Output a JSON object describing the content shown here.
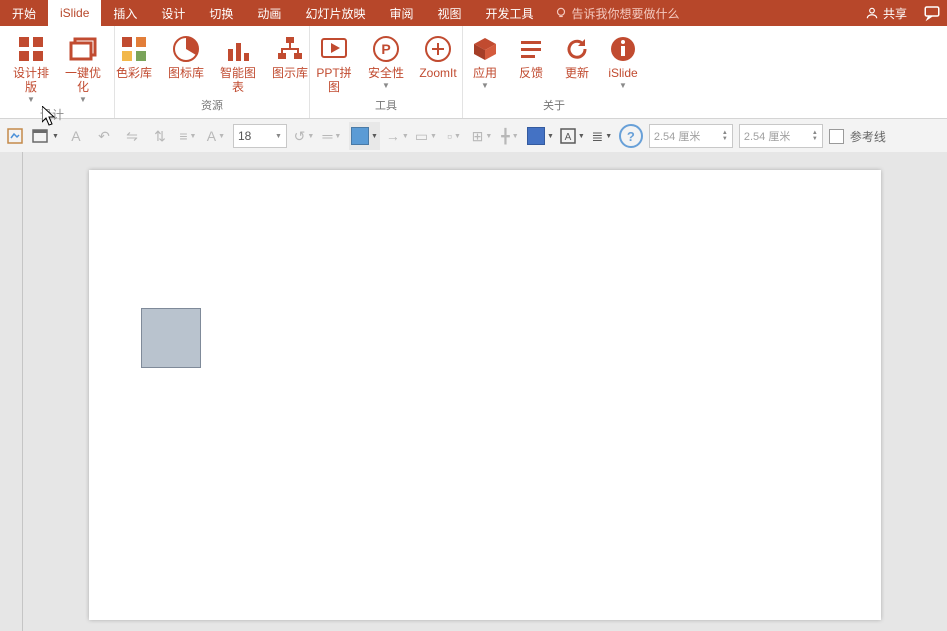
{
  "tabs": {
    "t0": "开始",
    "t1": "iSlide",
    "t2": "插入",
    "t3": "设计",
    "t4": "切换",
    "t5": "动画",
    "t6": "幻灯片放映",
    "t7": "审阅",
    "t8": "视图",
    "t9": "开发工具"
  },
  "tellme": "告诉我你想要做什么",
  "share": "共享",
  "ribbon": {
    "design_layout": "设计排版",
    "optimize": "一键优化",
    "colorlib": "色彩库",
    "iconlib": "图标库",
    "smartchart": "智能图表",
    "diagramlib": "图示库",
    "pptpuzzle": "PPT拼图",
    "security": "安全性",
    "zoomit": "ZoomIt",
    "app": "应用",
    "feedback": "反馈",
    "update": "更新",
    "islide": "iSlide",
    "g_design": "设计",
    "g_resource": "资源",
    "g_tool": "工具",
    "g_about": "关于"
  },
  "quick": {
    "fontsize": "18",
    "dim": "2.54 厘米",
    "guides": "参考线"
  },
  "hint_design": "设计"
}
